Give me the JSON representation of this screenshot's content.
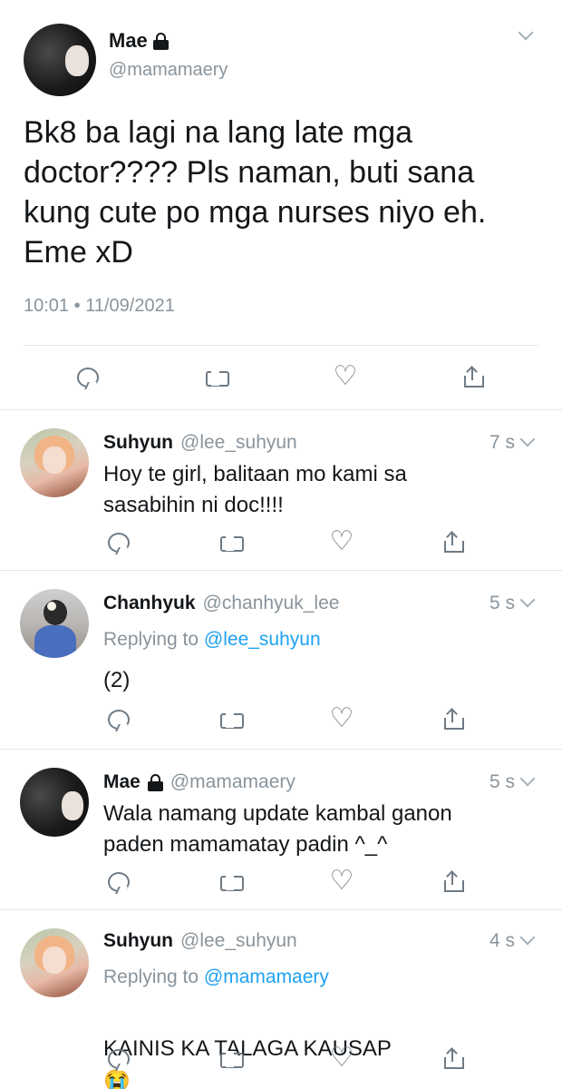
{
  "main_tweet": {
    "name": "Mae",
    "handle": "@mamamaery",
    "text": "Bk8 ba lagi na lang late mga\ndoctor???? Pls naman, buti sana\nkung cute po mga nurses niyo eh.\nEme xD",
    "time": "10:01",
    "separator": "•",
    "date": "11/09/2021",
    "icons": [
      "lock-icon",
      "chevron-down-icon",
      "reply-icon",
      "retweet-icon",
      "heart-icon",
      "share-icon"
    ]
  },
  "replies": [
    {
      "name": "Suhyun",
      "handle": "@lee_suhyun",
      "time": "7 s",
      "replying_to_label": "",
      "replying_to_mention": "",
      "text": "Hoy te girl, balitaan mo kami sa\nsasabihin ni doc!!!!"
    },
    {
      "name": "Chanhyuk",
      "handle": "@chanhyuk_lee",
      "time": "5 s",
      "replying_to_label": "Replying to ",
      "replying_to_mention": "@lee_suhyun",
      "text": "(2)"
    },
    {
      "name": "Mae",
      "handle": "@mamamaery",
      "time": "5 s",
      "replying_to_label": "",
      "replying_to_mention": "",
      "text": "Wala namang update kambal ganon\npaden mamamatay padin ^_^"
    },
    {
      "name": "Suhyun",
      "handle": "@lee_suhyun",
      "time": "4 s",
      "replying_to_label": "Replying to ",
      "replying_to_mention": "@mamamaery",
      "text": "KAINIS KA TALAGA KAUSAP",
      "emoji": "😭"
    }
  ],
  "colors": {
    "text": "#14171a",
    "secondary": "#8a949c",
    "link": "#1da1f2",
    "divider": "#e1e8ed",
    "icon": "#6e7a84"
  }
}
